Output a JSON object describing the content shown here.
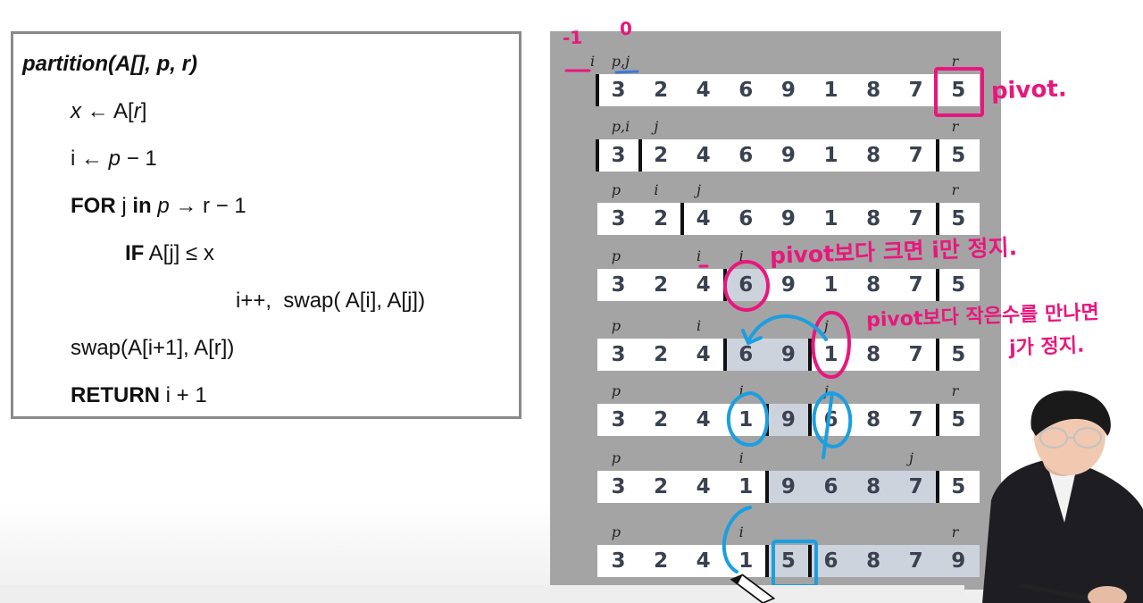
{
  "code": {
    "title": "partition(A[], p, r)",
    "lines": [
      {
        "parts": [
          {
            "t": "x",
            "s": "it"
          },
          {
            "t": " ← A["
          },
          {
            "t": "r",
            "s": "it"
          },
          {
            "t": "]"
          }
        ]
      },
      {
        "parts": [
          {
            "t": "i ← "
          },
          {
            "t": "p",
            "s": "it"
          },
          {
            "t": " − 1"
          }
        ]
      },
      {
        "parts": [
          {
            "t": "FOR",
            "s": "kw"
          },
          {
            "t": " j "
          },
          {
            "t": "in",
            "s": "kw"
          },
          {
            "t": " "
          },
          {
            "t": "p",
            "s": "it"
          },
          {
            "t": " → r − 1"
          }
        ]
      },
      {
        "parts": [
          {
            "t": "IF",
            "s": "kw"
          },
          {
            "t": " A[j] ≤ x"
          }
        ]
      },
      {
        "parts": [
          {
            "t": "i++,  swap( A[i], A[j])"
          }
        ]
      },
      {
        "parts": [
          {
            "t": "swap(A[i+1], A[r])"
          }
        ]
      },
      {
        "parts": [
          {
            "t": "RETURN",
            "s": "kw"
          },
          {
            "t": " i + 1"
          }
        ]
      }
    ]
  },
  "rows": [
    {
      "values": [
        "3",
        "2",
        "4",
        "6",
        "9",
        "1",
        "8",
        "7",
        "5"
      ],
      "labels": [
        {
          "t": "i",
          "c": -0.5
        },
        {
          "t": "p,j",
          "c": 0
        },
        {
          "t": "r",
          "c": 8
        }
      ],
      "walls": [
        0
      ],
      "shade": null
    },
    {
      "values": [
        "3",
        "2",
        "4",
        "6",
        "9",
        "1",
        "8",
        "7",
        "5"
      ],
      "labels": [
        {
          "t": "p,i",
          "c": 0
        },
        {
          "t": "j",
          "c": 1
        },
        {
          "t": "r",
          "c": 8
        }
      ],
      "walls": [
        0,
        1,
        8
      ],
      "shade": null
    },
    {
      "values": [
        "3",
        "2",
        "4",
        "6",
        "9",
        "1",
        "8",
        "7",
        "5"
      ],
      "labels": [
        {
          "t": "p",
          "c": 0
        },
        {
          "t": "i",
          "c": 1
        },
        {
          "t": "j",
          "c": 2
        },
        {
          "t": "r",
          "c": 8
        }
      ],
      "walls": [
        2,
        8
      ],
      "shade": null
    },
    {
      "values": [
        "3",
        "2",
        "4",
        "6",
        "9",
        "1",
        "8",
        "7",
        "5"
      ],
      "labels": [
        {
          "t": "p",
          "c": 0
        },
        {
          "t": "i",
          "c": 2
        },
        {
          "t": "i",
          "c": 3
        }
      ],
      "walls": [
        3,
        8
      ],
      "shade": [
        3,
        3
      ]
    },
    {
      "values": [
        "3",
        "2",
        "4",
        "6",
        "9",
        "1",
        "8",
        "7",
        "5"
      ],
      "labels": [
        {
          "t": "p",
          "c": 0
        },
        {
          "t": "i",
          "c": 2
        },
        {
          "t": "j",
          "c": 5
        }
      ],
      "walls": [
        3,
        5,
        8
      ],
      "shade": [
        3,
        4
      ]
    },
    {
      "values": [
        "3",
        "2",
        "4",
        "1",
        "9",
        "6",
        "8",
        "7",
        "5"
      ],
      "labels": [
        {
          "t": "p",
          "c": 0
        },
        {
          "t": "i",
          "c": 3
        },
        {
          "t": "j",
          "c": 5
        },
        {
          "t": "r",
          "c": 8
        }
      ],
      "walls": [
        4,
        5,
        8
      ],
      "shade": [
        4,
        4
      ]
    },
    {
      "values": [
        "3",
        "2",
        "4",
        "1",
        "9",
        "6",
        "8",
        "7",
        "5"
      ],
      "labels": [
        {
          "t": "p",
          "c": 0
        },
        {
          "t": "i",
          "c": 3
        },
        {
          "t": "j",
          "c": 7
        }
      ],
      "walls": [
        4,
        8
      ],
      "shade": [
        4,
        7
      ]
    },
    {
      "values": [
        "3",
        "2",
        "4",
        "1",
        "5",
        "6",
        "8",
        "7",
        "9"
      ],
      "labels": [
        {
          "t": "p",
          "c": 0
        },
        {
          "t": "i",
          "c": 3
        },
        {
          "t": "r",
          "c": 8
        }
      ],
      "walls": [
        4,
        5
      ],
      "shade": [
        4,
        8
      ]
    }
  ],
  "annotations": {
    "pivot_note": "pivot.",
    "note_row4": "pivot보다 크면 i만 정지.",
    "note_row5_line1": "pivot보다 작은수를 만나면",
    "note_row5_line2": "j가 정지.",
    "mark_minus1": "-1",
    "mark_zero": "0"
  },
  "colors": {
    "pink": "#e8177c",
    "blue": "#1b9fe0",
    "panel_gray": "#a4a4a4",
    "shade": "#cdd3dc"
  }
}
